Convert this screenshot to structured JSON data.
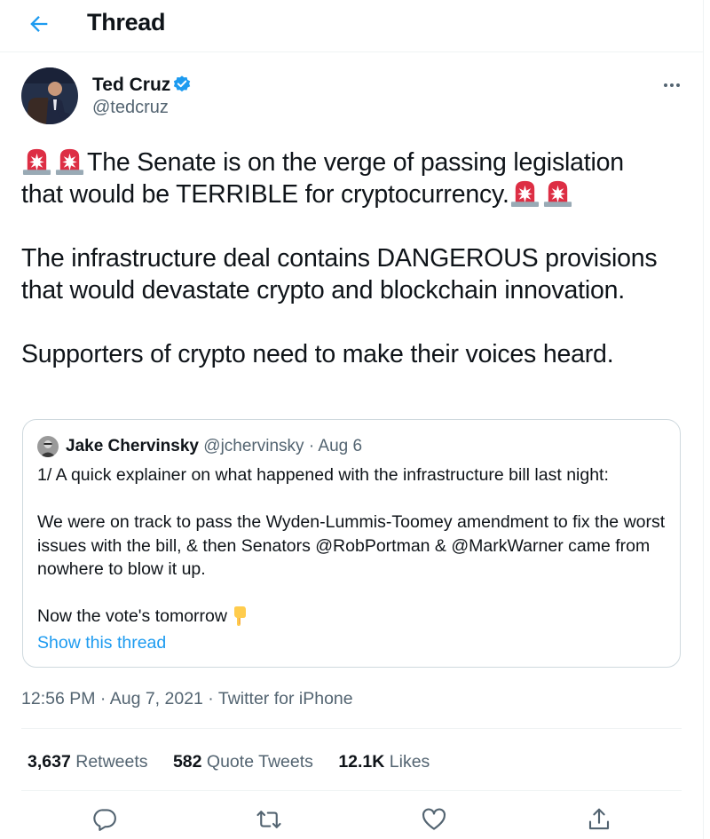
{
  "header": {
    "title": "Thread"
  },
  "author": {
    "name": "Ted Cruz",
    "handle": "@tedcruz"
  },
  "tweet": {
    "line1": "The Senate is on the verge of passing legislation",
    "line2": "that would be TERRIBLE for cryptocurrency.",
    "para2": "The infrastructure deal contains DANGEROUS provisions that would devastate crypto and blockchain innovation.",
    "para3": "Supporters of crypto need to make their voices heard."
  },
  "quote": {
    "name": "Jake Chervinsky",
    "handle": "@jchervinsky",
    "date": "Aug 6",
    "p1": "1/ A quick explainer on what happened with the infrastructure bill last night:",
    "p2": "We were on track to pass the Wyden-Lummis-Toomey amendment to fix the worst issues with the bill, & then Senators @RobPortman & @MarkWarner came from nowhere to blow it up.",
    "p3": "Now the vote's tomorrow",
    "show_thread": "Show this thread"
  },
  "meta": {
    "timestamp": "12:56 PM · Aug 7, 2021 · Twitter for iPhone"
  },
  "stats": {
    "retweets_count": "3,637",
    "retweets_label": "Retweets",
    "quotes_count": "582",
    "quotes_label": "Quote Tweets",
    "likes_count": "12.1K",
    "likes_label": "Likes"
  },
  "icons": {
    "back": "back-arrow-icon",
    "verified": "verified-badge-icon",
    "more": "more-icon",
    "siren": "police-light-emoji",
    "point_down": "point-down-emoji",
    "reply": "reply-icon",
    "retweet": "retweet-icon",
    "like": "like-icon",
    "share": "share-icon"
  },
  "colors": {
    "accent": "#1d9bf0",
    "secondary_text": "#536471",
    "text": "#0f1419",
    "border": "#cfd9de"
  }
}
